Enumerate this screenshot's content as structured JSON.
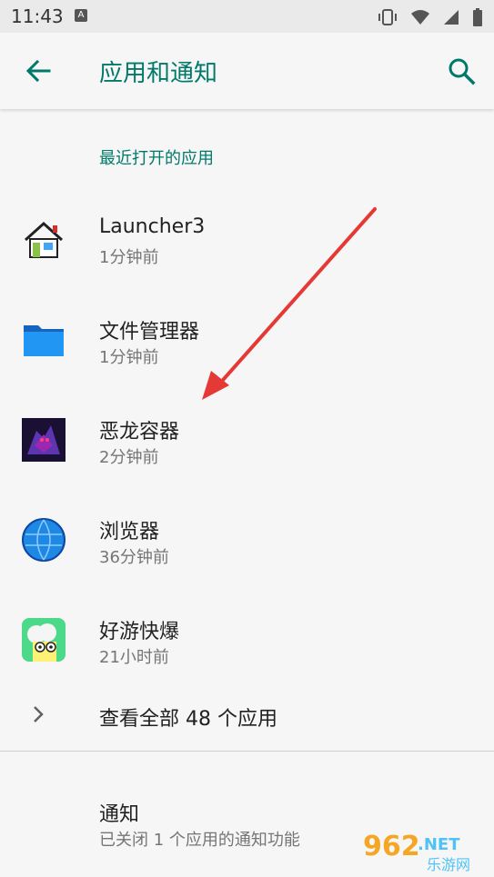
{
  "status_bar": {
    "time": "11:43",
    "a_badge": "A"
  },
  "header": {
    "title": "应用和通知",
    "back_icon": "arrow-back-icon",
    "search_icon": "search-icon",
    "accent": "#00796b"
  },
  "recent": {
    "header": "最近打开的应用",
    "apps": [
      {
        "name": "Launcher3",
        "time": "1分钟前",
        "icon": "house-icon"
      },
      {
        "name": "文件管理器",
        "time": "1分钟前",
        "icon": "folder-icon"
      },
      {
        "name": "恶龙容器",
        "time": "2分钟前",
        "icon": "dragon-icon"
      },
      {
        "name": "浏览器",
        "time": "36分钟前",
        "icon": "globe-icon"
      },
      {
        "name": "好游快爆",
        "time": "21小时前",
        "icon": "mascot-icon"
      }
    ]
  },
  "see_all": {
    "label": "查看全部 48 个应用"
  },
  "notifications": {
    "title": "通知",
    "subtitle": "已关闭 1 个应用的通知功能"
  },
  "watermark": {
    "brand": "962",
    "suffix": ".NET",
    "site": "乐游网"
  }
}
